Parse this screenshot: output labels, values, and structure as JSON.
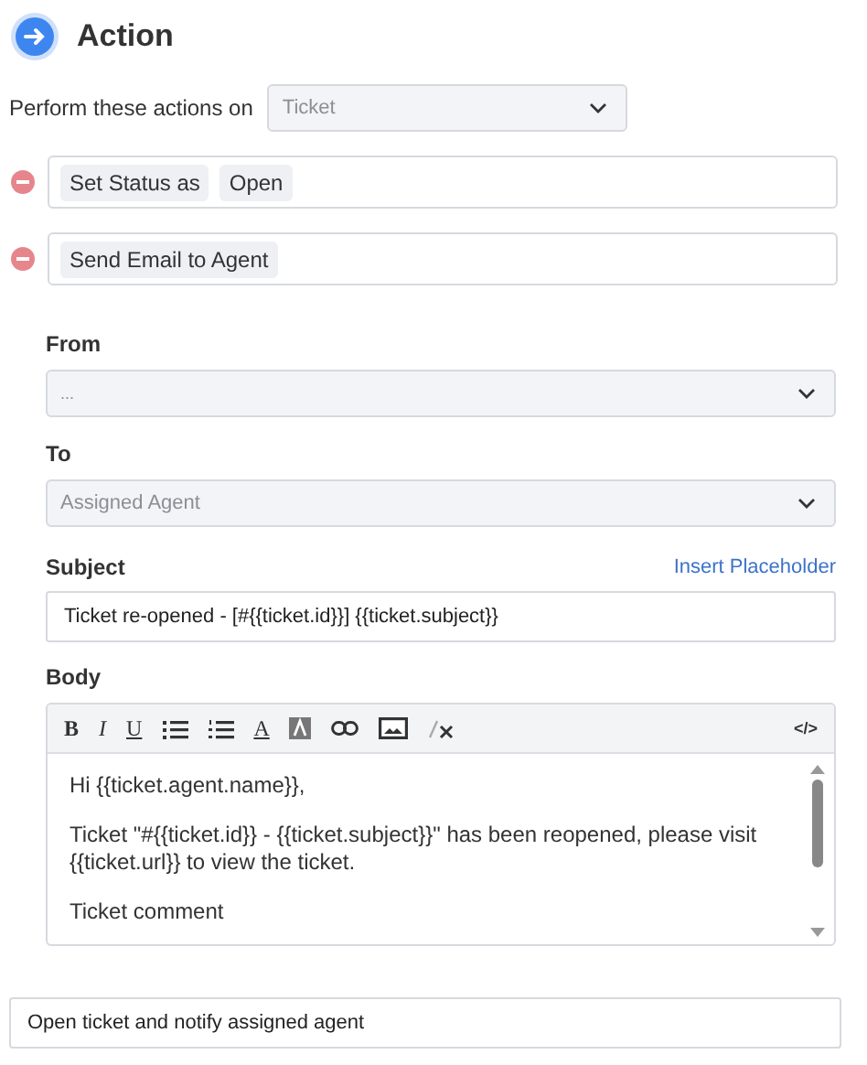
{
  "header": {
    "title": "Action"
  },
  "target": {
    "label": "Perform these actions on",
    "value": "Ticket"
  },
  "actions": [
    {
      "tags": [
        "Set Status as",
        "Open"
      ]
    },
    {
      "tags": [
        "Send Email to Agent"
      ]
    }
  ],
  "from": {
    "label": "From",
    "value": "..."
  },
  "to": {
    "label": "To",
    "value": "Assigned Agent"
  },
  "subject": {
    "label": "Subject",
    "link": "Insert Placeholder",
    "value": "Ticket re-opened - [#{{ticket.id}}] {{ticket.subject}}"
  },
  "body": {
    "label": "Body",
    "toolbar": [
      {
        "kind": "bold",
        "label": "B"
      },
      {
        "kind": "italic",
        "label": "I"
      },
      {
        "kind": "underline",
        "label": "U"
      },
      {
        "kind": "bullets"
      },
      {
        "kind": "numbers"
      },
      {
        "kind": "color",
        "label": "A"
      },
      {
        "kind": "background"
      },
      {
        "kind": "link"
      },
      {
        "kind": "image"
      },
      {
        "kind": "clear"
      },
      {
        "kind": "code",
        "label": "</>"
      }
    ],
    "paragraphs": [
      "Hi {{ticket.agent.name}},",
      "Ticket \"#{{ticket.id}} - {{ticket.subject}}\" has been reopened, please visit {{ticket.url}} to view the ticket.",
      "Ticket comment"
    ]
  },
  "name": {
    "value": "Open ticket and notify assigned agent"
  }
}
